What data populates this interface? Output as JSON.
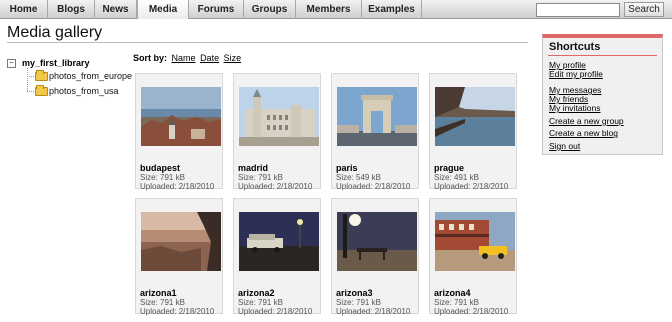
{
  "nav": {
    "tabs": [
      "Home",
      "Blogs",
      "News",
      "Media",
      "Forums",
      "Groups",
      "Members",
      "Examples"
    ],
    "active": "Media"
  },
  "search": {
    "placeholder": "",
    "button_label": "Search"
  },
  "page_title": "Media gallery",
  "tree": {
    "toggle": "−",
    "root": "my_first_library",
    "children": [
      "photos_from_europe",
      "photos_from_usa"
    ]
  },
  "sort": {
    "label": "Sort by:",
    "options": [
      "Name",
      "Date",
      "Size"
    ]
  },
  "gallery": [
    {
      "name": "budapest",
      "size": "Size: 791 kB",
      "uploaded": "Uploaded: 2/18/2010"
    },
    {
      "name": "madrid",
      "size": "Size: 791 kB",
      "uploaded": "Uploaded: 2/18/2010"
    },
    {
      "name": "paris",
      "size": "Size: 549 kB",
      "uploaded": "Uploaded: 2/18/2010"
    },
    {
      "name": "prague",
      "size": "Size: 491 kB",
      "uploaded": "Uploaded: 2/18/2010"
    },
    {
      "name": "arizona1",
      "size": "Size: 791 kB",
      "uploaded": "Uploaded: 2/18/2010"
    },
    {
      "name": "arizona2",
      "size": "Size: 791 kB",
      "uploaded": "Uploaded: 2/18/2010"
    },
    {
      "name": "arizona3",
      "size": "Size: 791 kB",
      "uploaded": "Uploaded: 2/18/2010"
    },
    {
      "name": "arizona4",
      "size": "Size: 791 kB",
      "uploaded": "Uploaded: 2/18/2010"
    }
  ],
  "shortcuts": {
    "title": "Shortcuts",
    "links": [
      "My profile",
      "Edit my profile",
      "My messages",
      "My friends",
      "My invitations",
      "Create a new group",
      "Create a new blog",
      "Sign out"
    ]
  },
  "colors": {
    "accent": "#e06767",
    "card_bg": "#f2f2f2",
    "nav_gradient_top": "#f2f2f2",
    "nav_gradient_bottom": "#cfcfcf"
  }
}
